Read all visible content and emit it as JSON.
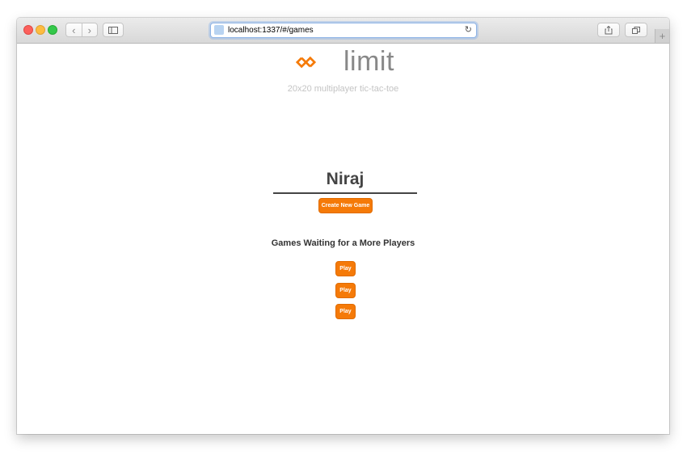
{
  "browser": {
    "url": "localhost:1337/#/games",
    "new_tab_glyph": "+",
    "reload_glyph": "↻",
    "back_glyph": "‹",
    "forward_glyph": "›"
  },
  "header": {
    "brand": "limit",
    "tagline": "20x20 multiplayer tic-tac-toe",
    "logo_icon": "infinity-diamond-logo"
  },
  "main": {
    "username": "Niraj",
    "create_label": "Create New Game",
    "waiting_title": "Games Waiting for a More Players",
    "games": [
      {
        "label": "Play"
      },
      {
        "label": "Play"
      },
      {
        "label": "Play"
      }
    ]
  },
  "colors": {
    "accent": "#f57a08",
    "text_dark": "#444444",
    "tagline": "#c4c4c4"
  }
}
